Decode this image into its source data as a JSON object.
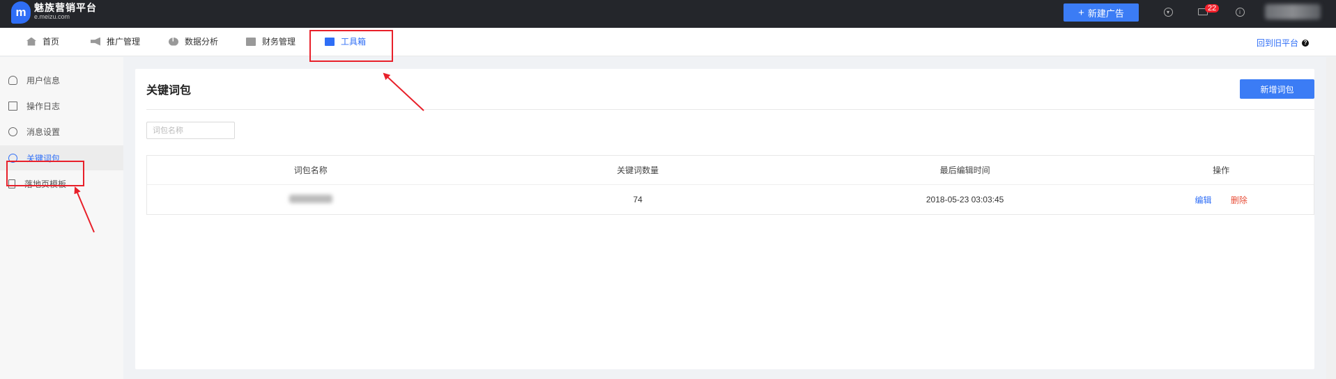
{
  "topbar": {
    "logo_letter": "m",
    "logo_title": "魅族营销平台",
    "logo_subtitle": "e.meizu.com",
    "new_ad_label": "新建广告",
    "mail_badge": "22"
  },
  "nav": {
    "items": [
      {
        "label": "首页",
        "icon": "home-icon"
      },
      {
        "label": "推广管理",
        "icon": "megaphone-icon"
      },
      {
        "label": "数据分析",
        "icon": "pie-chart-icon"
      },
      {
        "label": "财务管理",
        "icon": "safe-icon"
      },
      {
        "label": "工具箱",
        "icon": "toolbox-icon",
        "active": true
      }
    ],
    "back_label": "回到旧平台"
  },
  "sidebar": {
    "items": [
      {
        "label": "用户信息",
        "icon": "user-icon"
      },
      {
        "label": "操作日志",
        "icon": "log-icon"
      },
      {
        "label": "消息设置",
        "icon": "gear-icon"
      },
      {
        "label": "关键词包",
        "icon": "keyword-icon",
        "selected": true
      },
      {
        "label": "落地页模板",
        "icon": "page-icon"
      }
    ]
  },
  "main": {
    "title": "关键词包",
    "add_button": "新增词包",
    "search": {
      "placeholder": "词包名称",
      "value": ""
    },
    "table": {
      "columns": [
        "词包名称",
        "关键词数量",
        "最后编辑时间",
        "操作"
      ],
      "rows": [
        {
          "name": "",
          "count": "74",
          "edited": "2018-05-23 03:03:45",
          "actions": [
            "编辑",
            "删除"
          ]
        }
      ]
    }
  },
  "colors": {
    "accent": "#2f6ef6",
    "annotation": "#e8202a",
    "topbar": "#24262b"
  }
}
